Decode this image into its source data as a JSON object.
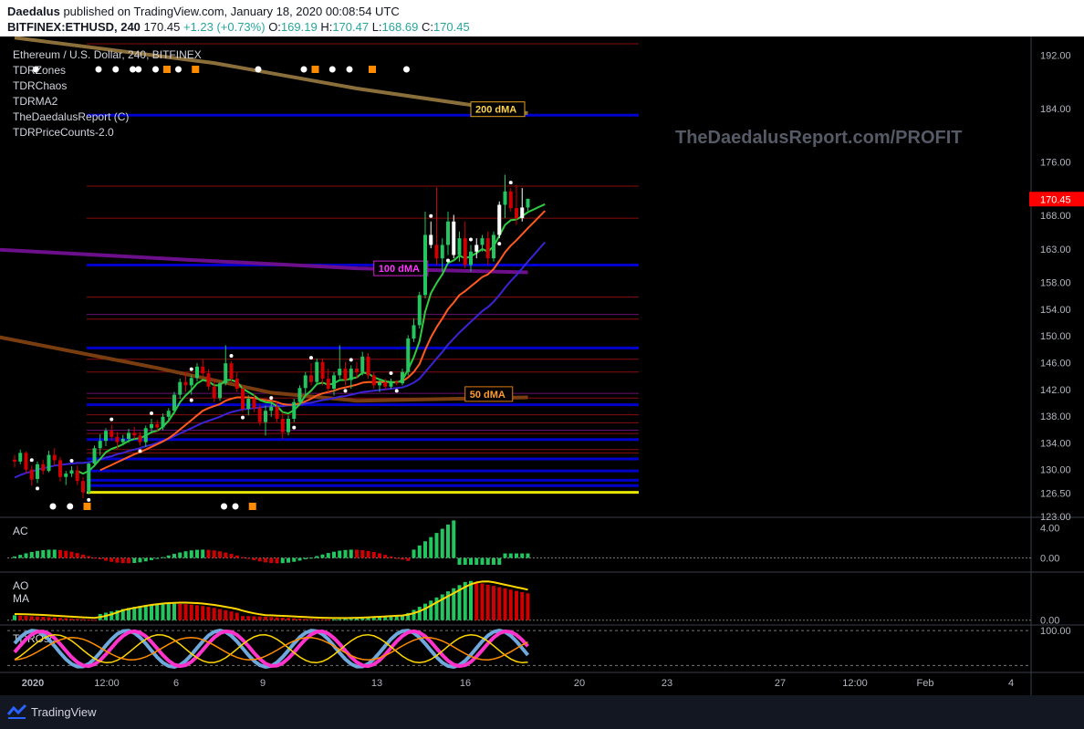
{
  "header": {
    "author": "Daedalus",
    "published": "published on TradingView.com, January 18, 2020 00:08:54 UTC",
    "symbol": "BITFINEX:ETHUSD, 240",
    "last": "170.45",
    "change": "+1.23 (+0.73%)",
    "o_label": "O:",
    "o_val": "169.19",
    "h_label": "H:",
    "h_val": "170.47",
    "l_label": "L:",
    "l_val": "168.69",
    "c_label": "C:",
    "c_val": "170.45"
  },
  "legend": {
    "title": "Ethereum / U.S. Dollar, 240, BITFINEX",
    "indicators": [
      "TDRZones",
      "TDRChaos",
      "TDRMA2",
      "TheDaedalusReport (C)",
      "TDRPriceCounts-2.0"
    ]
  },
  "watermark": "TheDaedalusReport.com/PROFIT",
  "footer": {
    "brand": "TradingView"
  },
  "colors": {
    "up": "#22c55e",
    "down": "#d00000",
    "ma200": "#8b6f3a",
    "ma100": "#6b0f8a",
    "ma50": "#7a3d10",
    "zone": "#0000cc",
    "support": "#e6e600",
    "fast": "#2ecc40",
    "mid": "#ff5a1f",
    "slow": "#3b23d6",
    "last_price_bg": "#ff0000"
  },
  "chart_data": {
    "type": "candlestick",
    "symbol": "ETHUSD",
    "timeframe": "240",
    "y_ticks": [
      192.0,
      184.0,
      176.0,
      168.0,
      163.0,
      158.0,
      154.0,
      150.0,
      146.0,
      142.0,
      138.0,
      134.0,
      130.0,
      126.5,
      123.0
    ],
    "y_tick_labels": [
      "192.00",
      "184.00",
      "176.00",
      "168.00",
      "163.00",
      "158.00",
      "154.00",
      "150.00",
      "146.00",
      "142.00",
      "138.00",
      "134.00",
      "130.00",
      "126.50",
      "123.00"
    ],
    "ylim": [
      123.0,
      194.5
    ],
    "x_ticks": [
      "2020",
      "12:00",
      "6",
      "9",
      "13",
      "16",
      "20",
      "23",
      "27",
      "12:00",
      "Feb",
      "4"
    ],
    "last_price": 170.45,
    "ma_labels": [
      {
        "text": "200 dMA",
        "color": "#ffd34d",
        "border": "#e0a020",
        "bg": "#000000",
        "value": 183.3
      },
      {
        "text": "100 dMA",
        "color": "#ff33ff",
        "border": "#cc22cc",
        "bg": "#000000",
        "value": 159.5
      },
      {
        "text": "50 dMA",
        "color": "#ff9a2e",
        "border": "#e07a10",
        "bg": "#000000",
        "value": 140.8
      }
    ],
    "zones": {
      "blue": [
        183.0,
        160.6,
        148.2,
        139.7,
        134.5,
        131.6,
        129.8,
        128.4,
        127.6
      ],
      "red": [
        194.0,
        172.4,
        167.6,
        155.8,
        152.5,
        146.5,
        144.6,
        140.7,
        138.2,
        137.0,
        135.4,
        133.0,
        132.5
      ],
      "yellow": 126.6
    },
    "candles": [
      [
        131.5,
        132.2,
        130.3,
        131.2
      ],
      [
        131.2,
        133.0,
        130.8,
        132.5
      ],
      [
        132.5,
        132.7,
        129.4,
        130.0
      ],
      [
        130.0,
        130.6,
        127.6,
        128.5
      ],
      [
        128.6,
        131.2,
        128.0,
        130.8
      ],
      [
        130.8,
        131.5,
        129.3,
        129.8
      ],
      [
        129.8,
        132.8,
        129.6,
        132.2
      ],
      [
        132.2,
        133.2,
        130.6,
        131.4
      ],
      [
        131.4,
        131.9,
        128.2,
        128.9
      ],
      [
        128.9,
        129.8,
        127.7,
        129.4
      ],
      [
        129.4,
        130.5,
        128.9,
        129.9
      ],
      [
        129.9,
        130.6,
        127.7,
        128.3
      ],
      [
        128.3,
        128.9,
        125.7,
        126.6
      ],
      [
        126.6,
        131.0,
        126.3,
        130.9
      ],
      [
        130.9,
        133.6,
        130.4,
        133.2
      ],
      [
        133.2,
        135.3,
        132.1,
        134.3
      ],
      [
        134.3,
        136.2,
        133.5,
        135.8
      ],
      [
        135.8,
        136.7,
        134.3,
        134.9
      ],
      [
        134.9,
        135.6,
        133.1,
        134.1
      ],
      [
        134.1,
        135.2,
        133.6,
        134.6
      ],
      [
        134.6,
        136.1,
        134.0,
        135.5
      ],
      [
        135.5,
        136.4,
        134.6,
        135.1
      ],
      [
        135.1,
        135.6,
        133.6,
        134.1
      ],
      [
        134.1,
        136.6,
        133.4,
        136.2
      ],
      [
        136.2,
        137.6,
        135.4,
        136.8
      ],
      [
        136.8,
        137.4,
        135.7,
        136.3
      ],
      [
        136.3,
        138.4,
        135.9,
        137.9
      ],
      [
        137.9,
        139.2,
        137.3,
        138.8
      ],
      [
        138.8,
        141.6,
        138.3,
        141.2
      ],
      [
        141.2,
        143.6,
        140.6,
        143.1
      ],
      [
        143.1,
        144.6,
        141.6,
        142.6
      ],
      [
        142.6,
        144.2,
        141.2,
        143.7
      ],
      [
        143.7,
        145.9,
        143.2,
        145.4
      ],
      [
        145.4,
        146.6,
        143.9,
        144.4
      ],
      [
        144.4,
        145.0,
        141.9,
        142.4
      ],
      [
        142.4,
        143.6,
        140.1,
        140.7
      ],
      [
        140.7,
        143.1,
        140.3,
        142.9
      ],
      [
        142.9,
        148.6,
        142.6,
        145.9
      ],
      [
        145.9,
        146.2,
        143.1,
        143.6
      ],
      [
        143.6,
        144.6,
        141.6,
        142.1
      ],
      [
        142.1,
        142.6,
        138.6,
        139.1
      ],
      [
        139.1,
        141.1,
        138.1,
        140.6
      ],
      [
        140.6,
        141.2,
        138.6,
        139.2
      ],
      [
        139.2,
        139.7,
        136.6,
        137.1
      ],
      [
        137.1,
        139.6,
        135.1,
        138.8
      ],
      [
        138.8,
        139.9,
        137.9,
        139.4
      ],
      [
        139.4,
        140.1,
        137.1,
        137.6
      ],
      [
        137.6,
        138.6,
        134.6,
        135.6
      ],
      [
        135.6,
        138.1,
        135.1,
        137.6
      ],
      [
        137.6,
        140.6,
        137.1,
        140.1
      ],
      [
        140.1,
        142.6,
        139.6,
        142.2
      ],
      [
        142.2,
        144.6,
        141.1,
        144.1
      ],
      [
        144.1,
        145.9,
        142.6,
        143.1
      ],
      [
        143.1,
        146.6,
        142.6,
        146.1
      ],
      [
        146.1,
        146.6,
        142.6,
        143.6
      ],
      [
        143.6,
        145.1,
        141.6,
        142.1
      ],
      [
        142.1,
        144.6,
        141.1,
        144.1
      ],
      [
        144.1,
        148.6,
        143.6,
        145.1
      ],
      [
        145.1,
        146.1,
        142.6,
        143.4
      ],
      [
        143.4,
        145.6,
        142.1,
        145.1
      ],
      [
        145.1,
        146.1,
        143.6,
        144.6
      ],
      [
        144.6,
        147.6,
        144.1,
        146.9
      ],
      [
        146.9,
        147.4,
        143.6,
        144.1
      ],
      [
        144.1,
        144.6,
        142.1,
        142.6
      ],
      [
        142.6,
        143.6,
        141.6,
        143.1
      ],
      [
        143.1,
        143.6,
        141.9,
        142.4
      ],
      [
        142.4,
        143.6,
        142.1,
        143.1
      ],
      [
        143.1,
        143.4,
        142.6,
        142.9
      ],
      [
        142.9,
        145.1,
        142.6,
        144.6
      ],
      [
        144.6,
        150.1,
        144.1,
        149.6
      ],
      [
        149.6,
        152.6,
        149.1,
        151.6
      ],
      [
        151.6,
        156.6,
        151.1,
        156.1
      ],
      [
        156.1,
        168.6,
        155.6,
        165.1
      ],
      [
        165.1,
        167.1,
        163.1,
        163.6
      ],
      [
        163.6,
        172.2,
        160.6,
        161.6
      ],
      [
        161.6,
        164.6,
        159.6,
        163.6
      ],
      [
        163.6,
        168.6,
        162.1,
        167.1
      ],
      [
        167.1,
        168.1,
        161.6,
        162.1
      ],
      [
        162.1,
        165.6,
        161.1,
        164.6
      ],
      [
        164.6,
        167.1,
        160.1,
        160.6
      ],
      [
        160.6,
        163.6,
        159.6,
        162.6
      ],
      [
        162.6,
        164.6,
        161.6,
        163.6
      ],
      [
        163.6,
        165.1,
        162.6,
        164.6
      ],
      [
        164.6,
        165.6,
        160.6,
        161.6
      ],
      [
        161.6,
        165.6,
        161.1,
        165.1
      ],
      [
        165.1,
        170.1,
        164.6,
        169.6
      ],
      [
        169.6,
        174.1,
        167.6,
        171.6
      ],
      [
        171.6,
        172.1,
        168.6,
        169.1
      ],
      [
        169.1,
        172.6,
        166.6,
        167.6
      ],
      [
        167.6,
        172.1,
        167.1,
        169.2
      ],
      [
        169.2,
        170.5,
        168.7,
        170.5
      ]
    ],
    "ma_fast": [
      null,
      null,
      null,
      null,
      null,
      null,
      null,
      null,
      null,
      null,
      null,
      129.8,
      129.4,
      129.8,
      130.6,
      131.6,
      132.6,
      133.1,
      133.4,
      133.8,
      134.3,
      134.6,
      134.7,
      135.1,
      135.6,
      135.8,
      136.4,
      137.3,
      138.6,
      140.1,
      141.1,
      141.9,
      142.9,
      143.4,
      143.2,
      142.6,
      142.6,
      143.4,
      143.4,
      143.1,
      142.1,
      141.6,
      141.1,
      140.4,
      140.1,
      140.0,
      139.5,
      138.6,
      138.4,
      138.9,
      139.8,
      141.1,
      141.8,
      142.8,
      143.0,
      142.7,
      142.9,
      143.4,
      143.4,
      143.6,
      143.8,
      144.5,
      144.4,
      143.8,
      143.5,
      143.2,
      143.1,
      143.0,
      143.4,
      145.0,
      146.8,
      149.2,
      153.6,
      156.4,
      157.9,
      159.2,
      160.9,
      161.3,
      162.0,
      161.6,
      161.9,
      162.4,
      163.0,
      162.6,
      163.4,
      165.0,
      166.6,
      167.3,
      167.4,
      167.9,
      168.5
    ],
    "ma_mid": [
      null,
      null,
      null,
      null,
      null,
      null,
      null,
      null,
      null,
      null,
      null,
      null,
      null,
      null,
      null,
      129.9,
      130.3,
      130.7,
      131.1,
      131.5,
      131.9,
      132.3,
      132.6,
      133.0,
      133.4,
      133.8,
      134.2,
      134.7,
      135.3,
      136.0,
      136.7,
      137.4,
      138.1,
      138.8,
      139.2,
      139.5,
      139.8,
      140.3,
      140.6,
      140.8,
      140.8,
      140.8,
      140.7,
      140.5,
      140.4,
      140.3,
      140.1,
      139.8,
      139.7,
      139.7,
      139.9,
      140.2,
      140.6,
      141.1,
      141.4,
      141.6,
      141.8,
      142.1,
      142.3,
      142.5,
      142.7,
      143.0,
      143.1,
      143.1,
      143.1,
      143.1,
      143.1,
      143.1,
      143.2,
      143.8,
      144.6,
      145.8,
      147.9,
      149.8,
      151.3,
      152.6,
      154.0,
      155.0,
      156.1,
      156.7,
      157.4,
      158.1,
      158.8,
      159.2,
      160.0,
      161.2,
      162.5,
      163.5,
      164.3,
      165.2,
      166.1
    ],
    "ma_slow": [
      128.8,
      129.2,
      129.5,
      129.7,
      130.0,
      130.2,
      130.4,
      130.6,
      130.7,
      130.8,
      130.9,
      131.0,
      131.0,
      131.1,
      131.3,
      131.5,
      131.8,
      132.0,
      132.3,
      132.5,
      132.8,
      133.0,
      133.2,
      133.5,
      133.7,
      134.0,
      134.3,
      134.6,
      135.0,
      135.4,
      135.8,
      136.2,
      136.6,
      137.0,
      137.3,
      137.6,
      137.9,
      138.3,
      138.6,
      138.8,
      139.0,
      139.1,
      139.2,
      139.3,
      139.4,
      139.5,
      139.5,
      139.5,
      139.6,
      139.6,
      139.7,
      139.9,
      140.0,
      140.2,
      140.4,
      140.5,
      140.7,
      140.9,
      141.0,
      141.2,
      141.4,
      141.6,
      141.7,
      141.8,
      141.9,
      142.0,
      142.1,
      142.2,
      142.3,
      142.6,
      143.0,
      143.6,
      144.6,
      145.6,
      146.6,
      147.6,
      148.7,
      149.6,
      150.5,
      151.3,
      152.1,
      152.9,
      153.7,
      154.3,
      155.1,
      156.1,
      157.2,
      158.2,
      159.1,
      160.1,
      161.1
    ],
    "ma_extension_bars": 3,
    "ma200": [
      {
        "b": 0,
        "v": 194.6
      },
      {
        "b": 35,
        "v": 190.8
      },
      {
        "b": 60,
        "v": 187.0
      },
      {
        "b": 90,
        "v": 183.3
      }
    ],
    "ma100": [
      {
        "b": -5,
        "v": 163.0
      },
      {
        "b": 30,
        "v": 161.4
      },
      {
        "b": 60,
        "v": 160.1
      },
      {
        "b": 90,
        "v": 159.5
      }
    ],
    "ma50": [
      {
        "b": -5,
        "v": 150.2
      },
      {
        "b": 25,
        "v": 145.2
      },
      {
        "b": 45,
        "v": 141.5
      },
      {
        "b": 60,
        "v": 140.3
      },
      {
        "b": 90,
        "v": 140.8
      }
    ],
    "markers_top": [
      {
        "b": 5,
        "c": "w"
      },
      {
        "b": 16,
        "c": "w"
      },
      {
        "b": 19,
        "c": "w"
      },
      {
        "b": 22,
        "c": "w"
      },
      {
        "b": 23,
        "c": "w"
      },
      {
        "b": 26,
        "c": "w"
      },
      {
        "b": 28,
        "c": "o"
      },
      {
        "b": 30,
        "c": "w"
      },
      {
        "b": 33,
        "c": "o"
      },
      {
        "b": 44,
        "c": "w"
      },
      {
        "b": 52,
        "c": "w"
      },
      {
        "b": 54,
        "c": "o"
      },
      {
        "b": 57,
        "c": "w"
      },
      {
        "b": 60,
        "c": "w"
      },
      {
        "b": 64,
        "c": "o"
      },
      {
        "b": 70,
        "c": "w"
      }
    ],
    "markers_bottom": [
      {
        "b": 8,
        "c": "w"
      },
      {
        "b": 11,
        "c": "w"
      },
      {
        "b": 14,
        "c": "o"
      },
      {
        "b": 38,
        "c": "w"
      },
      {
        "b": 40,
        "c": "w"
      },
      {
        "b": 43,
        "c": "o"
      }
    ],
    "panes": [
      {
        "name": "AC",
        "labels": [
          "AC"
        ],
        "ticks": [
          "4.00",
          "0.00"
        ],
        "tick_values": [
          4,
          0
        ],
        "range": [
          -1.5,
          5.0
        ]
      },
      {
        "name": "AO",
        "labels": [
          "AO",
          "MA"
        ],
        "ticks": [
          "0.00"
        ],
        "tick_values": [
          0
        ],
        "range": [
          -0.5,
          11.0
        ]
      },
      {
        "name": "TDROsc",
        "labels": [
          "TDROsc"
        ],
        "ticks": [
          "100.00"
        ],
        "tick_values": [
          100
        ],
        "range": [
          -12,
          108
        ]
      }
    ]
  }
}
